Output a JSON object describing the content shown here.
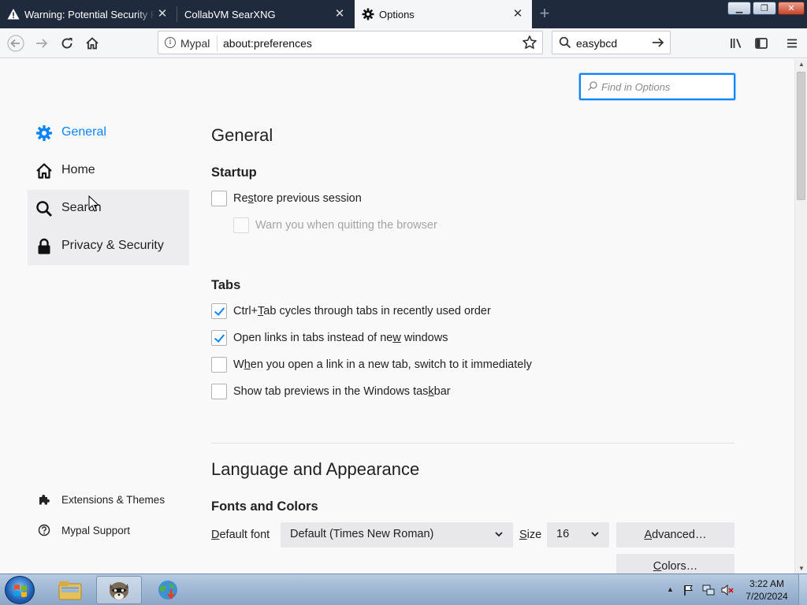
{
  "browser": {
    "tabs": [
      {
        "title": "Warning: Potential Security Risk Ahead",
        "active": false,
        "icon": "warning-icon"
      },
      {
        "title": "CollabVM SearXNG",
        "active": false,
        "icon": null
      },
      {
        "title": "Options",
        "active": true,
        "icon": "gear-icon"
      }
    ],
    "url_identity": "Mypal",
    "url": "about:preferences",
    "search_value": "easybcd"
  },
  "prefs": {
    "find_placeholder": "Find in Options",
    "categories": [
      {
        "label": "General",
        "icon": "gear-icon",
        "selected": true
      },
      {
        "label": "Home",
        "icon": "home-icon",
        "selected": false
      },
      {
        "label": "Search",
        "icon": "search-icon",
        "selected": false
      },
      {
        "label": "Privacy & Security",
        "icon": "lock-icon",
        "selected": false
      }
    ],
    "footer_links": [
      {
        "label": "Extensions & Themes",
        "icon": "puzzle-icon"
      },
      {
        "label": "Mypal Support",
        "icon": "help-icon"
      }
    ],
    "title": "General",
    "startup": {
      "heading": "Startup",
      "restore_session": {
        "label_pre": "Re",
        "label_key": "s",
        "label_post": "tore previous session",
        "checked": false
      },
      "warn_quit": {
        "label": "Warn you when quitting the browser",
        "checked": false,
        "disabled": true
      }
    },
    "tabs": {
      "heading": "Tabs",
      "ctrl_tab": {
        "label_pre": "Ctrl+",
        "label_key": "T",
        "label_post": "ab cycles through tabs in recently used order",
        "checked": true
      },
      "open_links": {
        "label_pre": "Open links in tabs instead of ne",
        "label_key": "w",
        "label_post": " windows",
        "checked": true
      },
      "switch_to": {
        "label_pre": "W",
        "label_key": "h",
        "label_post": "en you open a link in a new tab, switch to it immediately",
        "checked": false
      },
      "previews": {
        "label_pre": "Show tab previews in the Windows tas",
        "label_key": "k",
        "label_post": "bar",
        "checked": false
      }
    },
    "language_heading": "Language and Appearance",
    "fonts": {
      "heading": "Fonts and Colors",
      "default_font_label_key": "D",
      "default_font_label_rest": "efault font",
      "default_font_value": "Default (Times New Roman)",
      "size_label_key": "S",
      "size_label_rest": "ize",
      "size_value": "16",
      "advanced_key": "A",
      "advanced_rest": "dvanced…",
      "colors_key": "C",
      "colors_rest": "olors…"
    }
  },
  "taskbar": {
    "time": "3:22 AM",
    "date": "7/20/2024"
  },
  "colors": {
    "accent": "#0a84ff",
    "tabstrip": "#1f2b3d",
    "selected_category_bg": "#ededf0"
  }
}
